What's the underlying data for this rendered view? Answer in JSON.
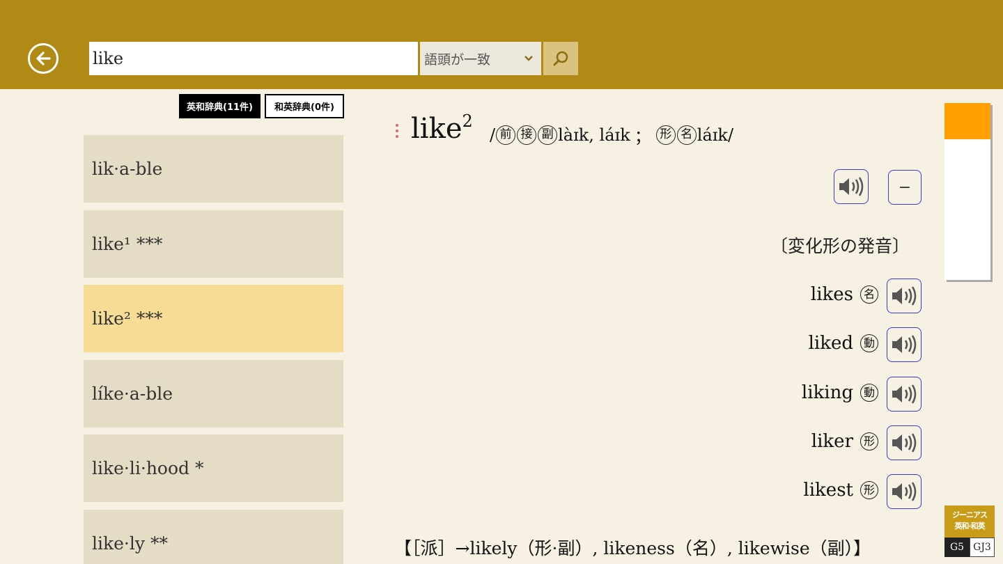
{
  "search": {
    "query": "like",
    "mode": "語頭が一致"
  },
  "tabs": {
    "english_japanese": "英和辞典(11件)",
    "japanese_english": "和英辞典(0件)"
  },
  "word_list": [
    {
      "text": "lik·a-ble",
      "selected": false
    },
    {
      "text": "like¹ ***",
      "selected": false
    },
    {
      "text": "like² ***",
      "selected": true
    },
    {
      "text": "líke·a-ble",
      "selected": false
    },
    {
      "text": "like·li·hood *",
      "selected": false
    },
    {
      "text": "like·ly **",
      "selected": false
    }
  ],
  "entry": {
    "headword": "like",
    "headword_sup": "2",
    "pron_open": "/",
    "pos_1": "前",
    "pos_2": "接",
    "pos_3": "副",
    "pron_1": "làɪk, láɪk",
    "pron_sep": "；",
    "pos_4": "形",
    "pos_5": "名",
    "pron_2": "láɪk/",
    "minus_label": "−",
    "inflection_heading": "〔変化形の発音〕",
    "inflections": [
      {
        "word": "likes",
        "pos": "名"
      },
      {
        "word": "liked",
        "pos": "動"
      },
      {
        "word": "liking",
        "pos": "動"
      },
      {
        "word": "liker",
        "pos": "形"
      },
      {
        "word": "likest",
        "pos": "形"
      }
    ],
    "derived": "【［派］→likely（形·副）, likeness（名）, likewise（副）】"
  },
  "logo": {
    "line1": "ジーニアス",
    "line2": "英和·和英",
    "g5": "G5",
    "gj3": "GJ3"
  },
  "colors": {
    "header": "#b08a14",
    "background": "#f6f1e2",
    "list_item": "#e4dcc5",
    "list_item_selected": "#f6dc95",
    "sound_border": "#3a3ad0",
    "scroll_thumb": "#ff9f00"
  }
}
